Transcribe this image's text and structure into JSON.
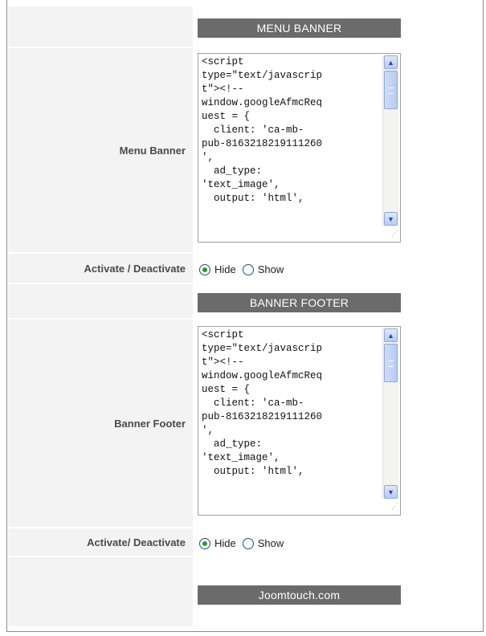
{
  "menu_section": {
    "header": "MENU BANNER",
    "label": "Menu Banner",
    "code": "<script\ntype=\"text/javascrip\nt\"><!--\nwindow.googleAfmcReq\nuest = {\n  client: 'ca-mb-\npub-8163218219111260\n',\n  ad_type:\n'text_image',\n  output: 'html',",
    "toggle_label": "Activate / Deactivate",
    "options": [
      "Hide",
      "Show"
    ],
    "selected": "Hide"
  },
  "footer_section": {
    "header": "BANNER FOOTER",
    "label": "Banner Footer",
    "code": "<script\ntype=\"text/javascrip\nt\"><!--\nwindow.googleAfmcReq\nuest = {\n  client: 'ca-mb-\npub-8163218219111260\n',\n  ad_type:\n'text_image',\n  output: 'html',",
    "toggle_label": "Activate/ Deactivate",
    "options": [
      "Hide",
      "Show"
    ],
    "selected": "Hide"
  },
  "footer_bar": {
    "text": "Joomtouch.com"
  },
  "colors": {
    "header_bg": "#6b6b6b",
    "label_bg": "#f3f3f3",
    "radio_selected": "#2a9a2a"
  }
}
